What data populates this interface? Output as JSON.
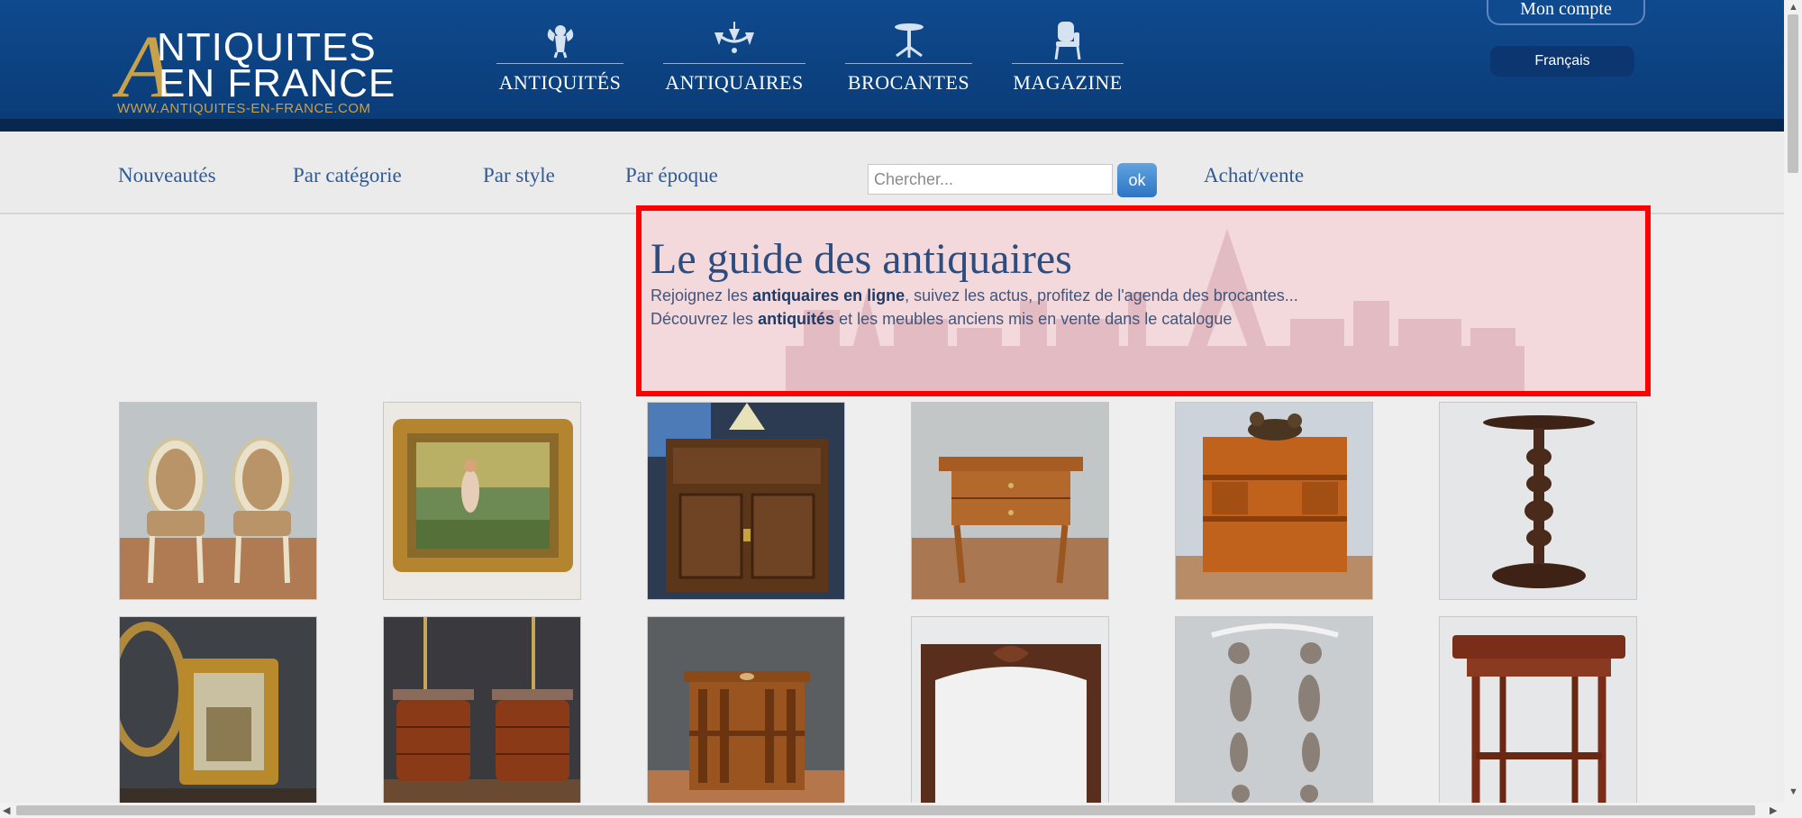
{
  "header": {
    "logo": {
      "letter": "A",
      "line1": "NTIQUITES",
      "line2": "EN FRANCE",
      "url": "WWW.ANTIQUITES-EN-FRANCE.COM"
    },
    "nav": [
      {
        "label": "ANTIQUITÉS",
        "icon": "cherub-icon"
      },
      {
        "label": "ANTIQUAIRES",
        "icon": "chandelier-icon"
      },
      {
        "label": "BROCANTES",
        "icon": "pedestal-table-icon"
      },
      {
        "label": "MAGAZINE",
        "icon": "armchair-icon"
      }
    ],
    "account": "Mon compte",
    "language": "Français"
  },
  "subnav": {
    "links": [
      "Nouveautés",
      "Par catégorie",
      "Par style",
      "Par époque"
    ],
    "search_placeholder": "Chercher...",
    "ok_label": "ok",
    "buy_sell": "Achat/vente"
  },
  "hero": {
    "title": "Le guide des antiquaires",
    "line1": {
      "pre": "Rejoignez les ",
      "bold": "antiquaires en ligne",
      "post": ", suivez les actus, profitez de l'agenda des brocantes..."
    },
    "line2": {
      "pre": "Découvrez les ",
      "bold": "antiquités",
      "post": " et les meubles anciens mis en vente dans le catalogue"
    }
  },
  "products": [
    "pair-of-louis-xvi-armchairs",
    "framed-oil-painting",
    "carved-wood-cabinet",
    "walnut-side-table",
    "revolving-bookcase-with-bronze",
    "twisted-pedestal-table",
    "gilded-mirror",
    "pair-of-marble-top-nightstands",
    "revolving-bookcase",
    "carved-fireplace-mantel",
    "antique-drop-earrings",
    "mahogany-side-table"
  ]
}
